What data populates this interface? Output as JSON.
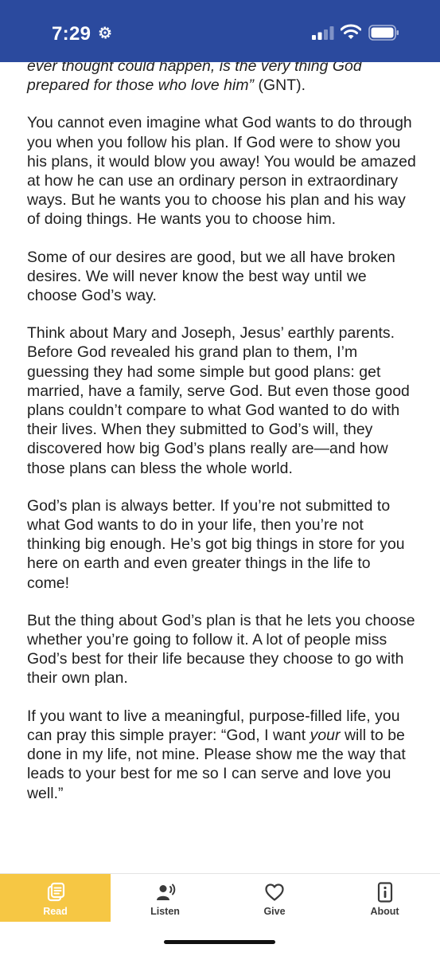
{
  "status_bar": {
    "time": "7:29",
    "icons": [
      "gear-icon",
      "signal-icon",
      "wifi-icon",
      "battery-icon"
    ],
    "background": "#2b4a9e"
  },
  "reading": {
    "p0_prefix_italic": "ever thought could happen, is the very thing God prepared for those who love him”",
    "p0_suffix": " (GNT).",
    "p1": "You cannot even imagine what God wants to do through you when you follow his plan. If God were to show you his plans, it would blow you away! You would be amazed at how he can use an ordinary person in extraordinary ways. But he wants you to choose his plan and his way of doing things. He wants you to choose him.",
    "p2": "Some of our desires are good, but we all have broken desires. We will never know the best way until we choose God’s way.",
    "p3": "Think about Mary and Joseph, Jesus’ earthly parents. Before God revealed his grand plan to them, I’m guessing they had some simple but good plans: get married, have a family, serve God. But even those good plans couldn’t compare to what God wanted to do with their lives. When they submitted to God’s will, they discovered how big God’s plans really are—and how those plans can bless the whole world.",
    "p4": "God’s plan is always better. If you’re not submitted to what God wants to do in your life, then you’re not thinking big enough. He’s got big things in store for you here on earth and even greater things in the life to come!",
    "p5": "But the thing about God’s plan is that he lets you choose whether you’re going to follow it. A lot of people miss God’s best for their life because they choose to go with their own plan.",
    "p6_a": "If you want to live a meaningful, purpose-filled life, you can pray this simple prayer: “God, I want ",
    "p6_italic": "your",
    "p6_b": " will to be done in my life, not mine. Please show me the way that leads to your best for me so I can serve and love you well.”"
  },
  "tabs": [
    {
      "label": "Read",
      "icon": "book-icon",
      "active": true
    },
    {
      "label": "Listen",
      "icon": "listen-icon",
      "active": false
    },
    {
      "label": "Give",
      "icon": "heart-icon",
      "active": false
    },
    {
      "label": "About",
      "icon": "info-icon",
      "active": false
    }
  ],
  "colors": {
    "active_tab": "#f6c744",
    "text": "#1f1f1f"
  }
}
